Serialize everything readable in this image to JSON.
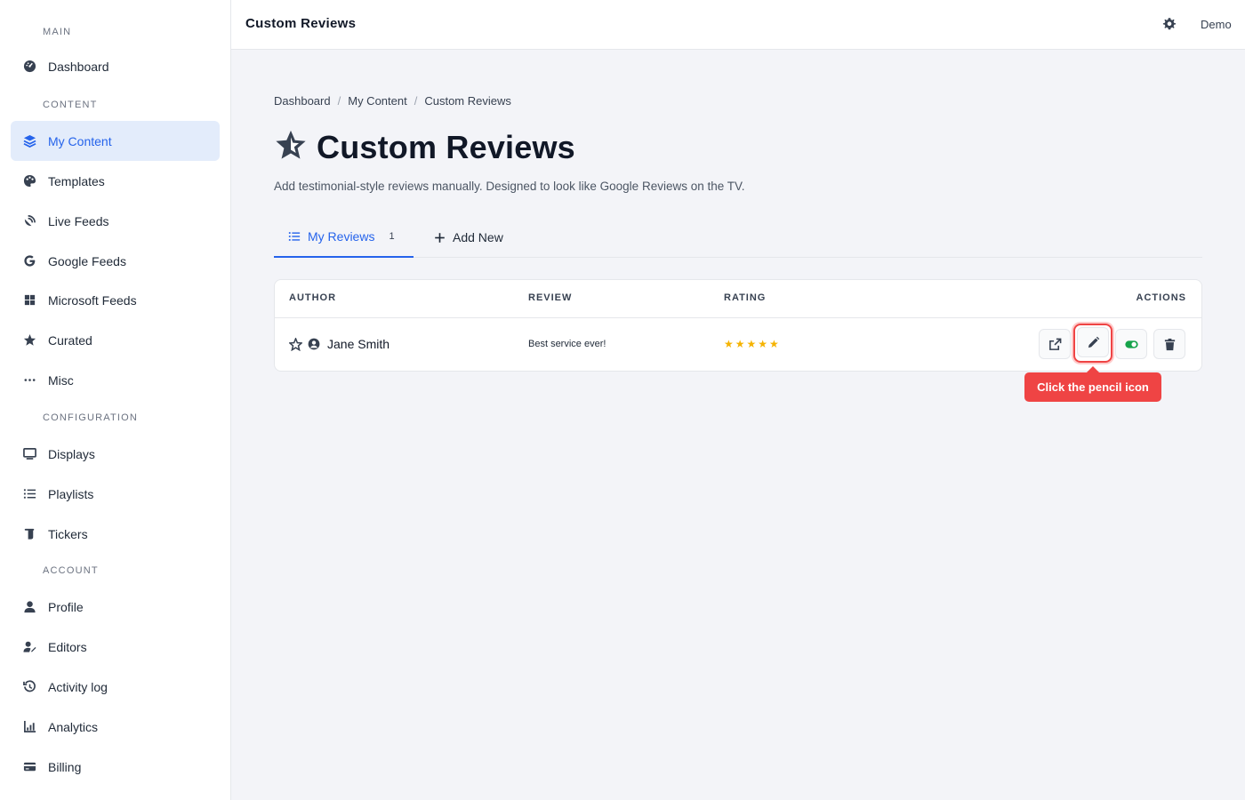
{
  "sidebar": {
    "sections": [
      "MAIN",
      "CONTENT",
      "CONFIGURATION",
      "ACCOUNT"
    ],
    "items": [
      {
        "label": "Dashboard",
        "icon": "dashboard-icon"
      },
      {
        "label": "My Content",
        "icon": "layers-icon",
        "active": true
      },
      {
        "label": "Templates",
        "icon": "palette-icon"
      },
      {
        "label": "Live Feeds",
        "icon": "satellite-dish-icon"
      },
      {
        "label": "Google Feeds",
        "icon": "google-icon"
      },
      {
        "label": "Microsoft Feeds",
        "icon": "windows-icon"
      },
      {
        "label": "Curated",
        "icon": "star-icon"
      },
      {
        "label": "Misc",
        "icon": "ellipsis-icon"
      },
      {
        "label": "Displays",
        "icon": "monitor-icon"
      },
      {
        "label": "Playlists",
        "icon": "list-icon"
      },
      {
        "label": "Tickers",
        "icon": "scroll-icon"
      },
      {
        "label": "Profile",
        "icon": "user-icon"
      },
      {
        "label": "Editors",
        "icon": "user-pen-icon"
      },
      {
        "label": "Activity log",
        "icon": "history-icon"
      },
      {
        "label": "Analytics",
        "icon": "chart-icon"
      },
      {
        "label": "Billing",
        "icon": "credit-card-icon"
      }
    ]
  },
  "topbar": {
    "title": "Custom Reviews",
    "user": "Demo"
  },
  "breadcrumb": [
    "Dashboard",
    "My Content",
    "Custom Reviews"
  ],
  "page": {
    "title": "Custom Reviews",
    "subtitle": "Add testimonial-style reviews manually. Designed to look like Google Reviews on the TV."
  },
  "tabs": [
    {
      "label": "My Reviews",
      "count": "1",
      "active": true
    },
    {
      "label": "Add New"
    }
  ],
  "table": {
    "headers": [
      "AUTHOR",
      "REVIEW",
      "RATING",
      "ACTIONS"
    ],
    "rows": [
      {
        "author": "Jane Smith",
        "review": "Best service ever!",
        "rating": 5,
        "stars": "★★★★★"
      }
    ]
  },
  "tooltip": "Click the pencil icon",
  "colors": {
    "accent": "#2563eb",
    "highlight": "#ef4444",
    "star": "#f5b301",
    "toggle": "#16a34a"
  }
}
